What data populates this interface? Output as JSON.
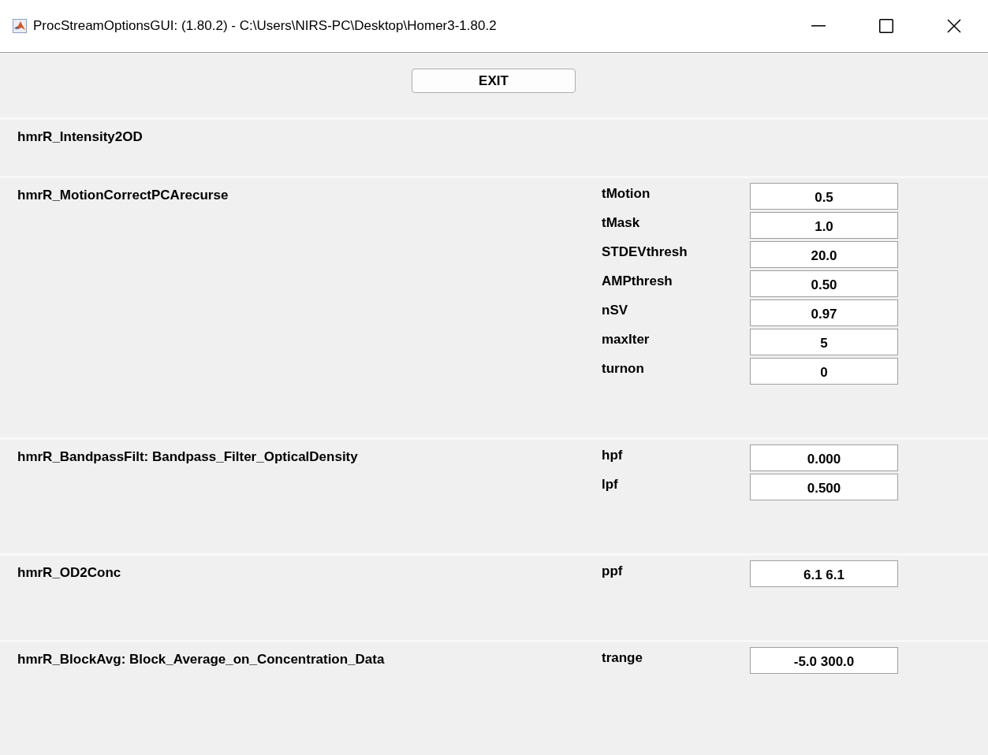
{
  "window": {
    "title": "ProcStreamOptionsGUI: (1.80.2) - C:\\Users\\NIRS-PC\\Desktop\\Homer3-1.80.2"
  },
  "exit_button": {
    "label": "EXIT"
  },
  "functions": [
    {
      "name": "hmrR_Intensity2OD"
    },
    {
      "name": "hmrR_MotionCorrectPCArecurse",
      "params": [
        {
          "label": "tMotion",
          "value": "0.5"
        },
        {
          "label": "tMask",
          "value": "1.0"
        },
        {
          "label": "STDEVthresh",
          "value": "20.0"
        },
        {
          "label": "AMPthresh",
          "value": "0.50"
        },
        {
          "label": "nSV",
          "value": "0.97"
        },
        {
          "label": "maxIter",
          "value": "5"
        },
        {
          "label": "turnon",
          "value": "0"
        }
      ]
    },
    {
      "name": "hmrR_BandpassFilt: Bandpass_Filter_OpticalDensity",
      "params": [
        {
          "label": "hpf",
          "value": "0.000"
        },
        {
          "label": "lpf",
          "value": "0.500"
        }
      ]
    },
    {
      "name": "hmrR_OD2Conc",
      "params": [
        {
          "label": "ppf",
          "value": "6.1 6.1"
        }
      ]
    },
    {
      "name": "hmrR_BlockAvg: Block_Average_on_Concentration_Data",
      "params": [
        {
          "label": "trange",
          "value": "-5.0 300.0"
        }
      ]
    }
  ]
}
